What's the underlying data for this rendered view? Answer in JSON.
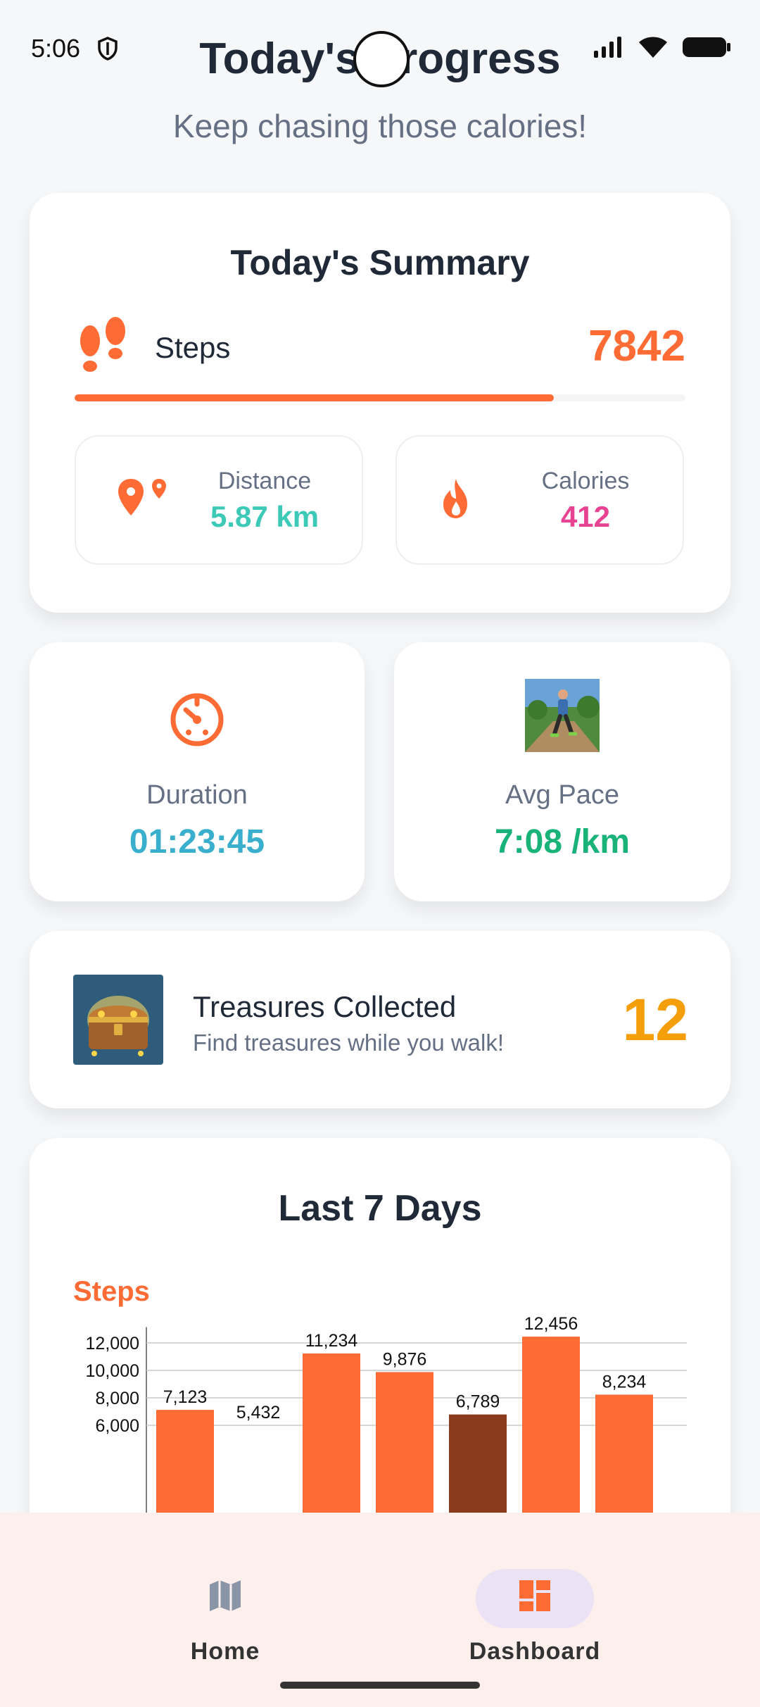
{
  "status_bar": {
    "time": "5:06"
  },
  "header": {
    "title": "Today's Progress",
    "subtitle": "Keep chasing those calories!"
  },
  "summary": {
    "title": "Today's Summary",
    "steps_label": "Steps",
    "steps_value": "7842",
    "steps_progress_percent": 78.4,
    "distance_label": "Distance",
    "distance_value": "5.87 km",
    "calories_label": "Calories",
    "calories_value": "412"
  },
  "duration": {
    "label": "Duration",
    "value": "01:23:45"
  },
  "pace": {
    "label": "Avg Pace",
    "value": "7:08 /km"
  },
  "treasures": {
    "title": "Treasures Collected",
    "subtitle": "Find treasures while you walk!",
    "count": "12"
  },
  "last7": {
    "title": "Last 7 Days",
    "subtitle": "Steps"
  },
  "chart_data": {
    "type": "bar",
    "title": "Last 7 Days",
    "ylabel": "Steps",
    "values": [
      7123,
      5432,
      11234,
      9876,
      6789,
      12456,
      8234
    ],
    "value_labels": [
      "7,123",
      "5,432",
      "11,234",
      "9,876",
      "6,789",
      "12,456",
      "8,234"
    ],
    "y_ticks": [
      6000,
      8000,
      10000,
      12000
    ],
    "y_tick_labels": [
      "6,000",
      "8,000",
      "10,000",
      "12,000"
    ],
    "ylim": [
      6000,
      13000
    ],
    "grid": true,
    "highlight_index": 4,
    "colors": {
      "bar": "#ff6b35",
      "highlight": "#8b3a1e"
    }
  },
  "nav": {
    "home_label": "Home",
    "dashboard_label": "Dashboard",
    "active": "Dashboard"
  },
  "colors": {
    "accent": "#ff6b35",
    "distance": "#3cc9b8",
    "calories": "#e84393",
    "duration": "#3aaecd",
    "pace": "#19b37a",
    "treasure": "#f59e0b"
  }
}
